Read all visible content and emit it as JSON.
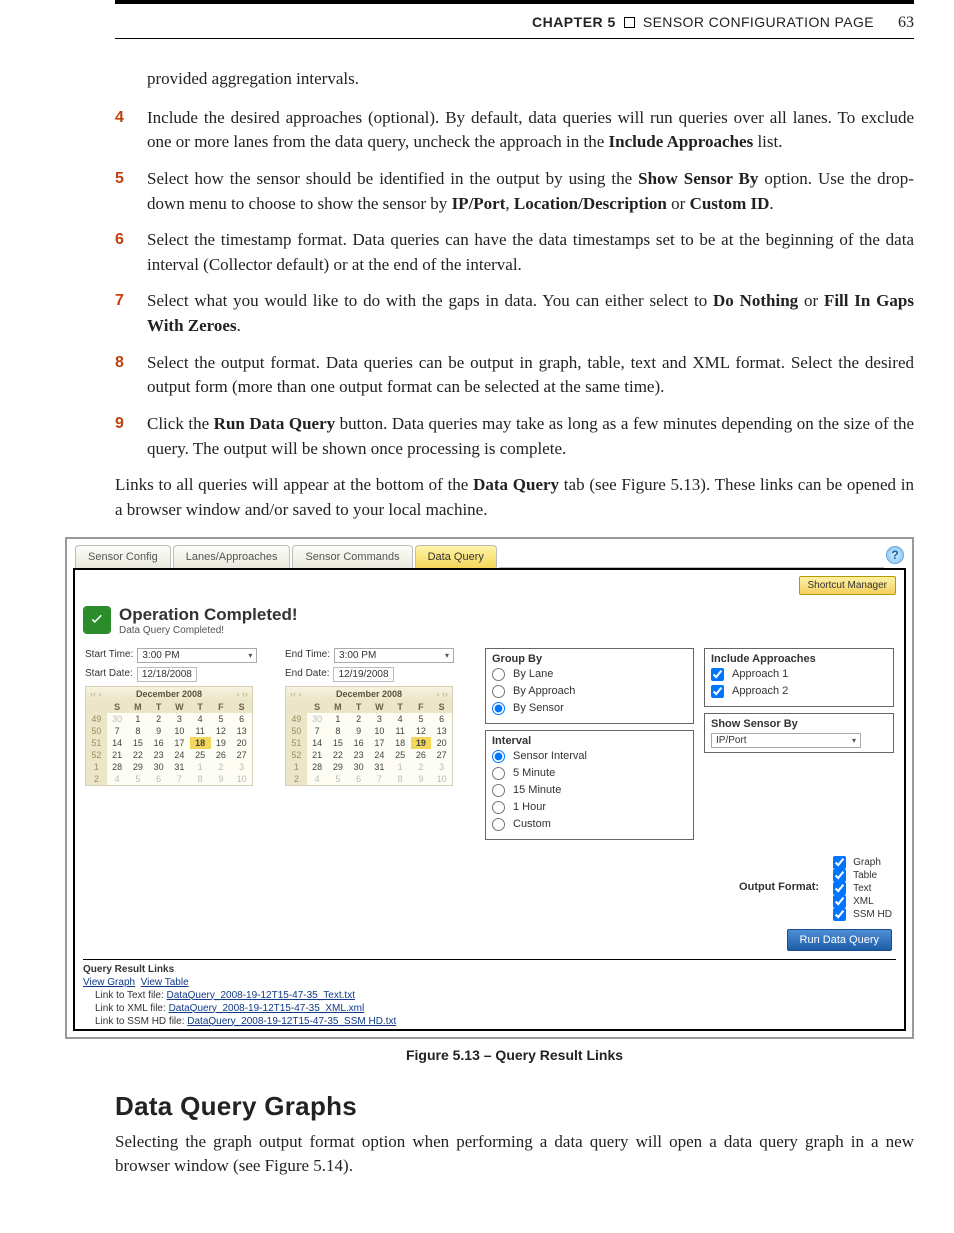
{
  "header": {
    "chapter": "CHAPTER 5",
    "title": "SENSOR CONFIGURATION PAGE",
    "page": "63"
  },
  "intro": "provided aggregation intervals.",
  "steps": [
    {
      "n": "4",
      "html": "Include the desired approaches (optional). By default, data queries will run queries over all lanes. To exclude one or more lanes from the data query, uncheck the approach in the <b>Include Approaches</b> list."
    },
    {
      "n": "5",
      "html": "Select how the sensor should be identified in the output by using the <b>Show Sensor By</b> option. Use the drop-down menu to choose to show the sensor by <b>IP/Port</b>, <b>Location/Description</b> or <b>Custom ID</b>."
    },
    {
      "n": "6",
      "html": "Select the timestamp format. Data queries can have the data timestamps set to be at the beginning of the data interval (Collector default) or at the end of the interval."
    },
    {
      "n": "7",
      "html": "Select what you would like to do with the gaps in data. You can either select to <b>Do Nothing</b> or <b>Fill In Gaps With Zeroes</b>."
    },
    {
      "n": "8",
      "html": "Select the output format. Data queries can be output in graph, table, text and XML format. Select the desired output form (more than one output format can be selected at the same time)."
    },
    {
      "n": "9",
      "html": "Click the <b>Run Data Query</b> button. Data queries may take as long as a few minutes depending on the size of the query. The output will be shown once processing is complete."
    }
  ],
  "para_links": "Links to all queries will appear at the bottom of the <b>Data Query</b> tab (see Figure 5.13). These links can be opened in a browser window and/or saved to your local machine.",
  "caption": "Figure 5.13 – Query Result Links",
  "section_heading": "Data Query Graphs",
  "section_para": "Selecting the graph output format option when performing a data query will open a data query graph in a new browser window (see Figure 5.14).",
  "shot": {
    "tabs": [
      "Sensor Config",
      "Lanes/Approaches",
      "Sensor Commands",
      "Data Query"
    ],
    "active_tab": 3,
    "shortcut": "Shortcut Manager",
    "banner": {
      "h": "Operation Completed!",
      "s": "Data Query Completed!"
    },
    "start": {
      "time_lbl": "Start Time:",
      "time": "3:00 PM",
      "date_lbl": "Start Date:",
      "date": "12/18/2008"
    },
    "end": {
      "time_lbl": "End Time:",
      "time": "3:00 PM",
      "date_lbl": "End Date:",
      "date": "12/19/2008"
    },
    "cal_month": "December 2008",
    "cal_days": [
      "S",
      "M",
      "T",
      "W",
      "T",
      "F",
      "S"
    ],
    "cal_weeks": [
      {
        "wk": "49",
        "d": [
          "30",
          "1",
          "2",
          "3",
          "4",
          "5",
          "6"
        ],
        "out": [
          0
        ]
      },
      {
        "wk": "50",
        "d": [
          "7",
          "8",
          "9",
          "10",
          "11",
          "12",
          "13"
        ]
      },
      {
        "wk": "51",
        "d": [
          "14",
          "15",
          "16",
          "17",
          "18",
          "19",
          "20"
        ]
      },
      {
        "wk": "52",
        "d": [
          "21",
          "22",
          "23",
          "24",
          "25",
          "26",
          "27"
        ]
      },
      {
        "wk": "1",
        "d": [
          "28",
          "29",
          "30",
          "31",
          "1",
          "2",
          "3"
        ],
        "out": [
          4,
          5,
          6
        ]
      },
      {
        "wk": "2",
        "d": [
          "4",
          "5",
          "6",
          "7",
          "8",
          "9",
          "10"
        ],
        "out": [
          0,
          1,
          2,
          3,
          4,
          5,
          6
        ]
      }
    ],
    "sel_start_idx": {
      "row": 2,
      "col": 4
    },
    "sel_end_idx": {
      "row": 2,
      "col": 5
    },
    "group_by": {
      "h": "Group By",
      "opts": [
        "By Lane",
        "By Approach",
        "By Sensor"
      ],
      "sel": 2
    },
    "interval": {
      "h": "Interval",
      "opts": [
        "Sensor Interval",
        "5 Minute",
        "15 Minute",
        "1 Hour",
        "Custom"
      ],
      "sel": 0
    },
    "include": {
      "h": "Include Approaches",
      "items": [
        "Approach 1",
        "Approach 2"
      ]
    },
    "show_sensor": {
      "h": "Show Sensor By",
      "val": "IP/Port"
    },
    "output": {
      "lbl": "Output Format:",
      "opts": [
        "Graph",
        "Table",
        "Text",
        "XML",
        "SSM HD"
      ]
    },
    "run": "Run Data Query",
    "qrl": {
      "h": "Query Result Links",
      "top": [
        "View Graph",
        "View Table"
      ],
      "rows": [
        {
          "pre": "Link to Text file: ",
          "link": "DataQuery_2008-19-12T15-47-35_Text.txt"
        },
        {
          "pre": "Link to XML file: ",
          "link": "DataQuery_2008-19-12T15-47-35_XML.xml"
        },
        {
          "pre": "Link to SSM HD file: ",
          "link": "DataQuery_2008-19-12T15-47-35_SSM HD.txt"
        }
      ]
    }
  }
}
